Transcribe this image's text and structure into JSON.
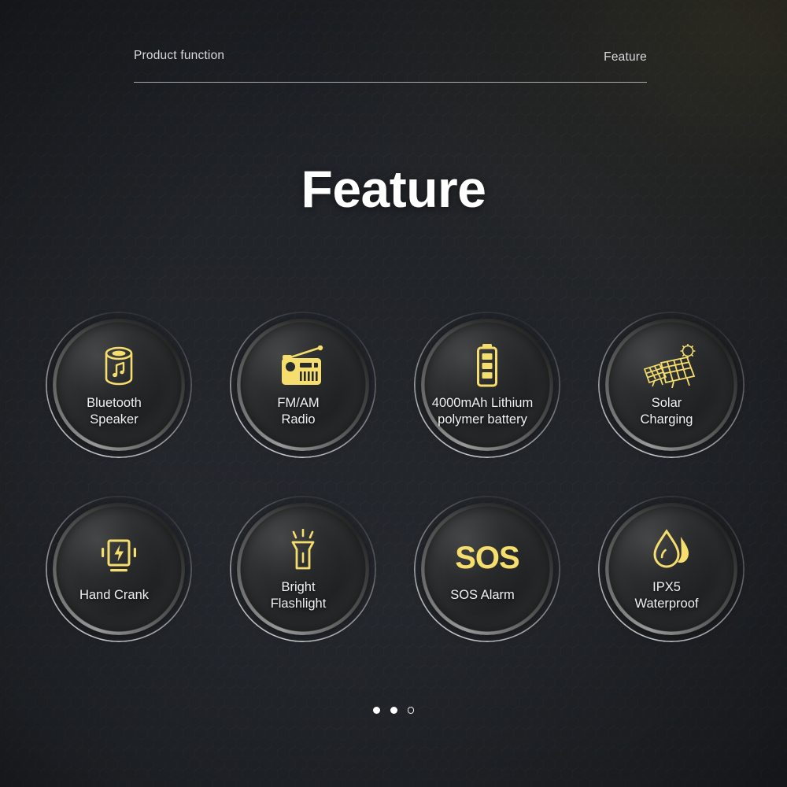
{
  "header": {
    "left_label": "Product function",
    "right_label": "Feature"
  },
  "page_title": "Feature",
  "colors": {
    "accent_yellow": "#f5de6e",
    "text_primary": "#ffffff",
    "text_secondary": "#d8dadd",
    "background_dark": "#24272c",
    "background_warm": "#2b2a24"
  },
  "features": [
    {
      "icon": "bluetooth-speaker-icon",
      "label": "Bluetooth\nSpeaker"
    },
    {
      "icon": "fm-am-radio-icon",
      "label": "FM/AM\nRadio"
    },
    {
      "icon": "battery-icon",
      "label": "4000mAh Lithium\npolymer battery"
    },
    {
      "icon": "solar-panel-icon",
      "label": "Solar\nCharging"
    },
    {
      "icon": "hand-crank-charge-icon",
      "label": "Hand Crank"
    },
    {
      "icon": "flashlight-icon",
      "label": "Bright\nFlashlight"
    },
    {
      "icon": "sos-icon",
      "label": "SOS Alarm",
      "icon_text": "SOS"
    },
    {
      "icon": "water-drop-icon",
      "label": "IPX5\nWaterproof"
    }
  ],
  "pagination": {
    "dots": [
      "filled",
      "filled",
      "hollow"
    ],
    "count": 3,
    "active_index": 2
  }
}
